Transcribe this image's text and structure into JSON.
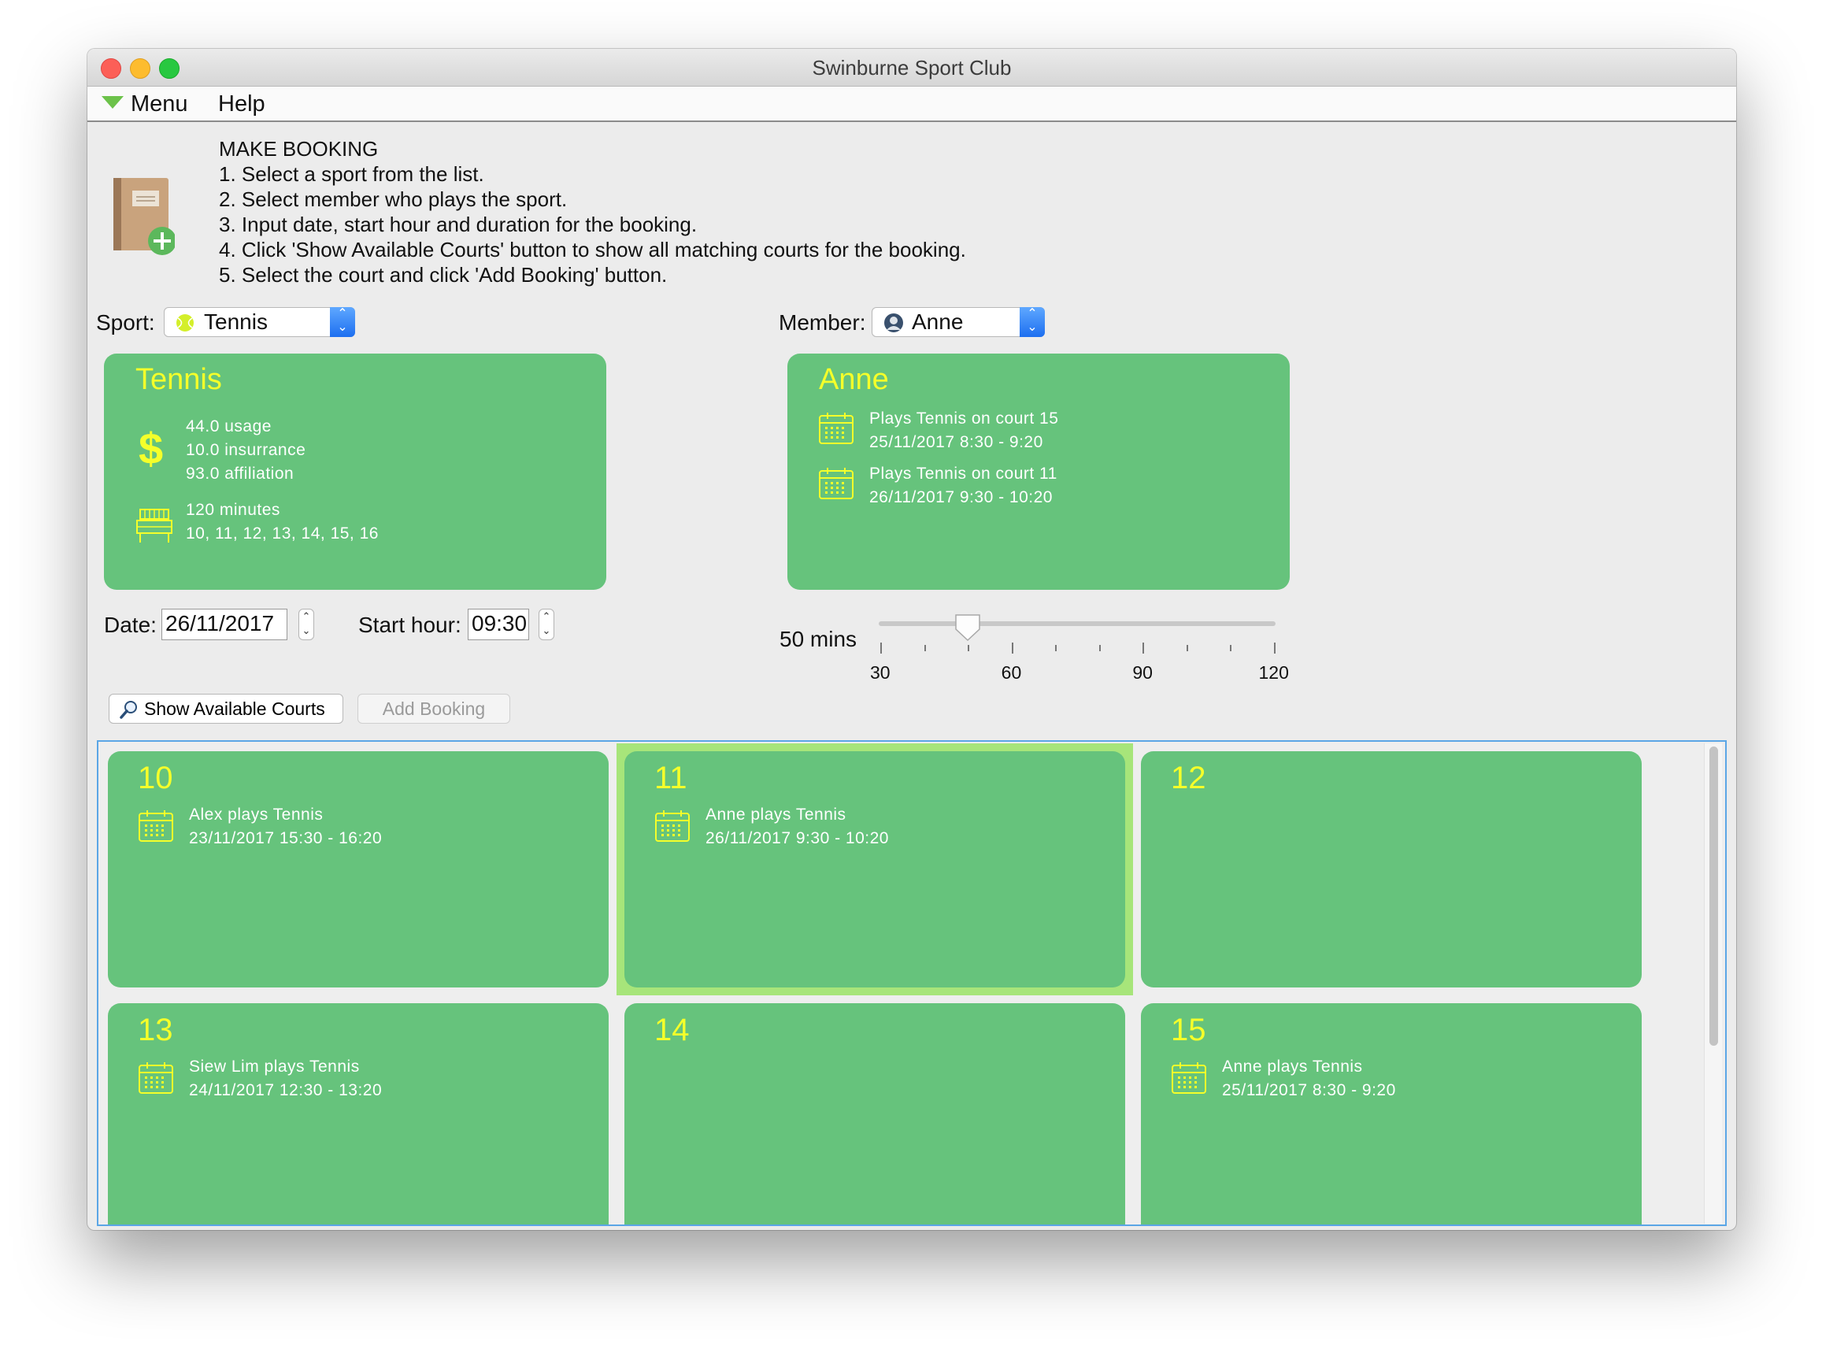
{
  "window": {
    "title": "Swinburne Sport Club"
  },
  "menubar": {
    "menu": "Menu",
    "help": "Help"
  },
  "instructions": {
    "heading": "MAKE BOOKING",
    "steps": [
      "1. Select a sport from the list.",
      "2. Select member who plays the sport.",
      "3. Input date, start hour and duration for the booking.",
      "4. Click 'Show Available Courts' button to show all matching courts for the booking.",
      "5. Select the court and click 'Add Booking' button."
    ]
  },
  "sport": {
    "label": "Sport:",
    "selected": "Tennis"
  },
  "member": {
    "label": "Member:",
    "selected": "Anne"
  },
  "sport_card": {
    "title": "Tennis",
    "fees": [
      "44.0 usage",
      "10.0 insurrance",
      "93.0 affiliation"
    ],
    "duration": "120 minutes",
    "courts": "10, 11, 12, 13, 14, 15, 16"
  },
  "member_card": {
    "title": "Anne",
    "bookings": [
      {
        "line1": "Plays Tennis on court 15",
        "line2": "25/11/2017 8:30 - 9:20"
      },
      {
        "line1": "Plays Tennis on court 11",
        "line2": "26/11/2017 9:30 - 10:20"
      }
    ]
  },
  "date": {
    "label": "Date:",
    "value": "26/11/2017"
  },
  "start_hour": {
    "label": "Start hour:",
    "value": "09:30"
  },
  "duration_slider": {
    "label": "50 mins",
    "value": 50,
    "min": 30,
    "max": 120,
    "ticks": [
      "30",
      "60",
      "90",
      "120"
    ]
  },
  "buttons": {
    "show": "Show Available Courts",
    "add": "Add Booking"
  },
  "courts": [
    {
      "number": "10",
      "booking": "Alex plays Tennis",
      "time": "23/11/2017 15:30 - 16:20",
      "selected": false
    },
    {
      "number": "11",
      "booking": "Anne plays Tennis",
      "time": "26/11/2017 9:30 - 10:20",
      "selected": true
    },
    {
      "number": "12",
      "booking": "",
      "time": "",
      "selected": false
    },
    {
      "number": "13",
      "booking": "Siew Lim plays Tennis",
      "time": "24/11/2017 12:30 - 13:20",
      "selected": false
    },
    {
      "number": "14",
      "booking": "",
      "time": "",
      "selected": false
    },
    {
      "number": "15",
      "booking": "Anne plays Tennis",
      "time": "25/11/2017 8:30 - 9:20",
      "selected": false
    }
  ],
  "colors": {
    "card": "#66c37c",
    "title_yellow": "#f5ff2a",
    "selected_border": "#a7e57a",
    "focus_blue": "#5ba6e6"
  }
}
